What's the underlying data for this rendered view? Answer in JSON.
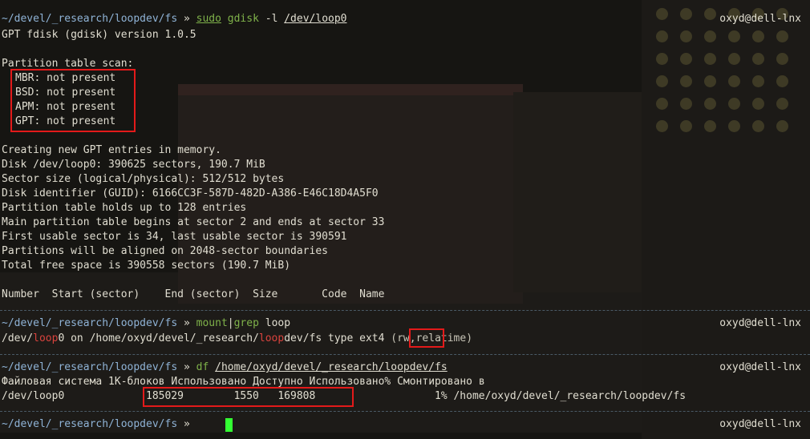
{
  "prompt": {
    "path": "~/devel/_research/loopdev/fs",
    "arrow": "»",
    "host": "oxyd@dell-lnx"
  },
  "cmd1": {
    "sudo": "sudo",
    "prog": "gdisk",
    "flag": "-l",
    "target": "/dev/loop0"
  },
  "gdisk": {
    "version": "GPT fdisk (gdisk) version 1.0.5",
    "scan_header": "Partition table scan:",
    "scan": [
      "MBR: not present",
      "BSD: not present",
      "APM: not present",
      "GPT: not present"
    ],
    "info": [
      "Creating new GPT entries in memory.",
      "Disk /dev/loop0: 390625 sectors, 190.7 MiB",
      "Sector size (logical/physical): 512/512 bytes",
      "Disk identifier (GUID): 6166CC3F-587D-482D-A386-E46C18D4A5F0",
      "Partition table holds up to 128 entries",
      "Main partition table begins at sector 2 and ends at sector 33",
      "First usable sector is 34, last usable sector is 390591",
      "Partitions will be aligned on 2048-sector boundaries",
      "Total free space is 390558 sectors (190.7 MiB)"
    ],
    "table_header": "Number  Start (sector)    End (sector)  Size       Code  Name"
  },
  "cmd2": {
    "prog": "mount",
    "pipe": "|",
    "prog2": "grep",
    "arg": "loop"
  },
  "mount_out": {
    "pre": "/dev/",
    "hl1": "loop",
    "mid": "0 on /home/oxyd/devel/_research/",
    "hl2": "loop",
    "mid2": "dev/fs type ",
    "fstype": "ext4",
    "post": " (rw,relatime)"
  },
  "cmd3": {
    "prog": "df",
    "arg": "/home/oxyd/devel/_research/loopdev/fs"
  },
  "df_out": {
    "header": "Файловая система 1K-блоков Использовано Доступно Использовано% Смонтировано в",
    "device": "/dev/loop0",
    "values": "185029        1550   169808",
    "rest": "1% /home/oxyd/devel/_research/loopdev/fs"
  },
  "colors": {
    "highlight_box": "#e31a1a",
    "cursor": "#33ff33",
    "command": "#7fb24a",
    "path": "#8fb3d6"
  }
}
